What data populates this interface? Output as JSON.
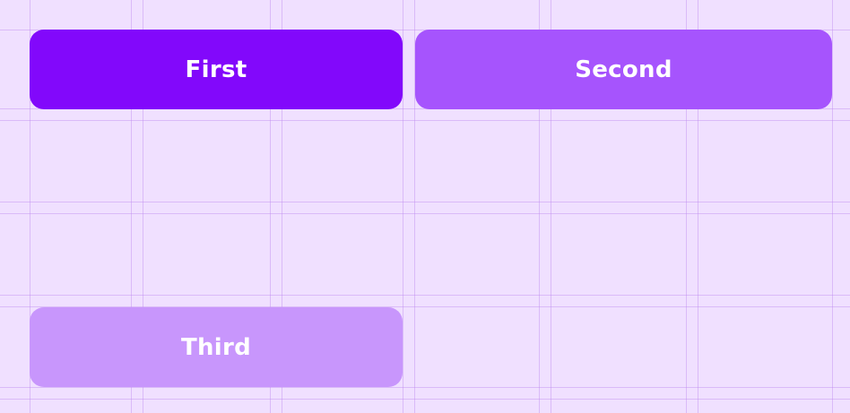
{
  "colors": {
    "background": "#f0e0ff",
    "grid_line": "#d8b4f8",
    "tile_first": "#8208fb",
    "tile_second": "#a654fd",
    "tile_third": "#c896fc",
    "tile_text": "#ffffff"
  },
  "tiles": [
    {
      "label": "First"
    },
    {
      "label": "Second"
    },
    {
      "label": "Third"
    }
  ]
}
